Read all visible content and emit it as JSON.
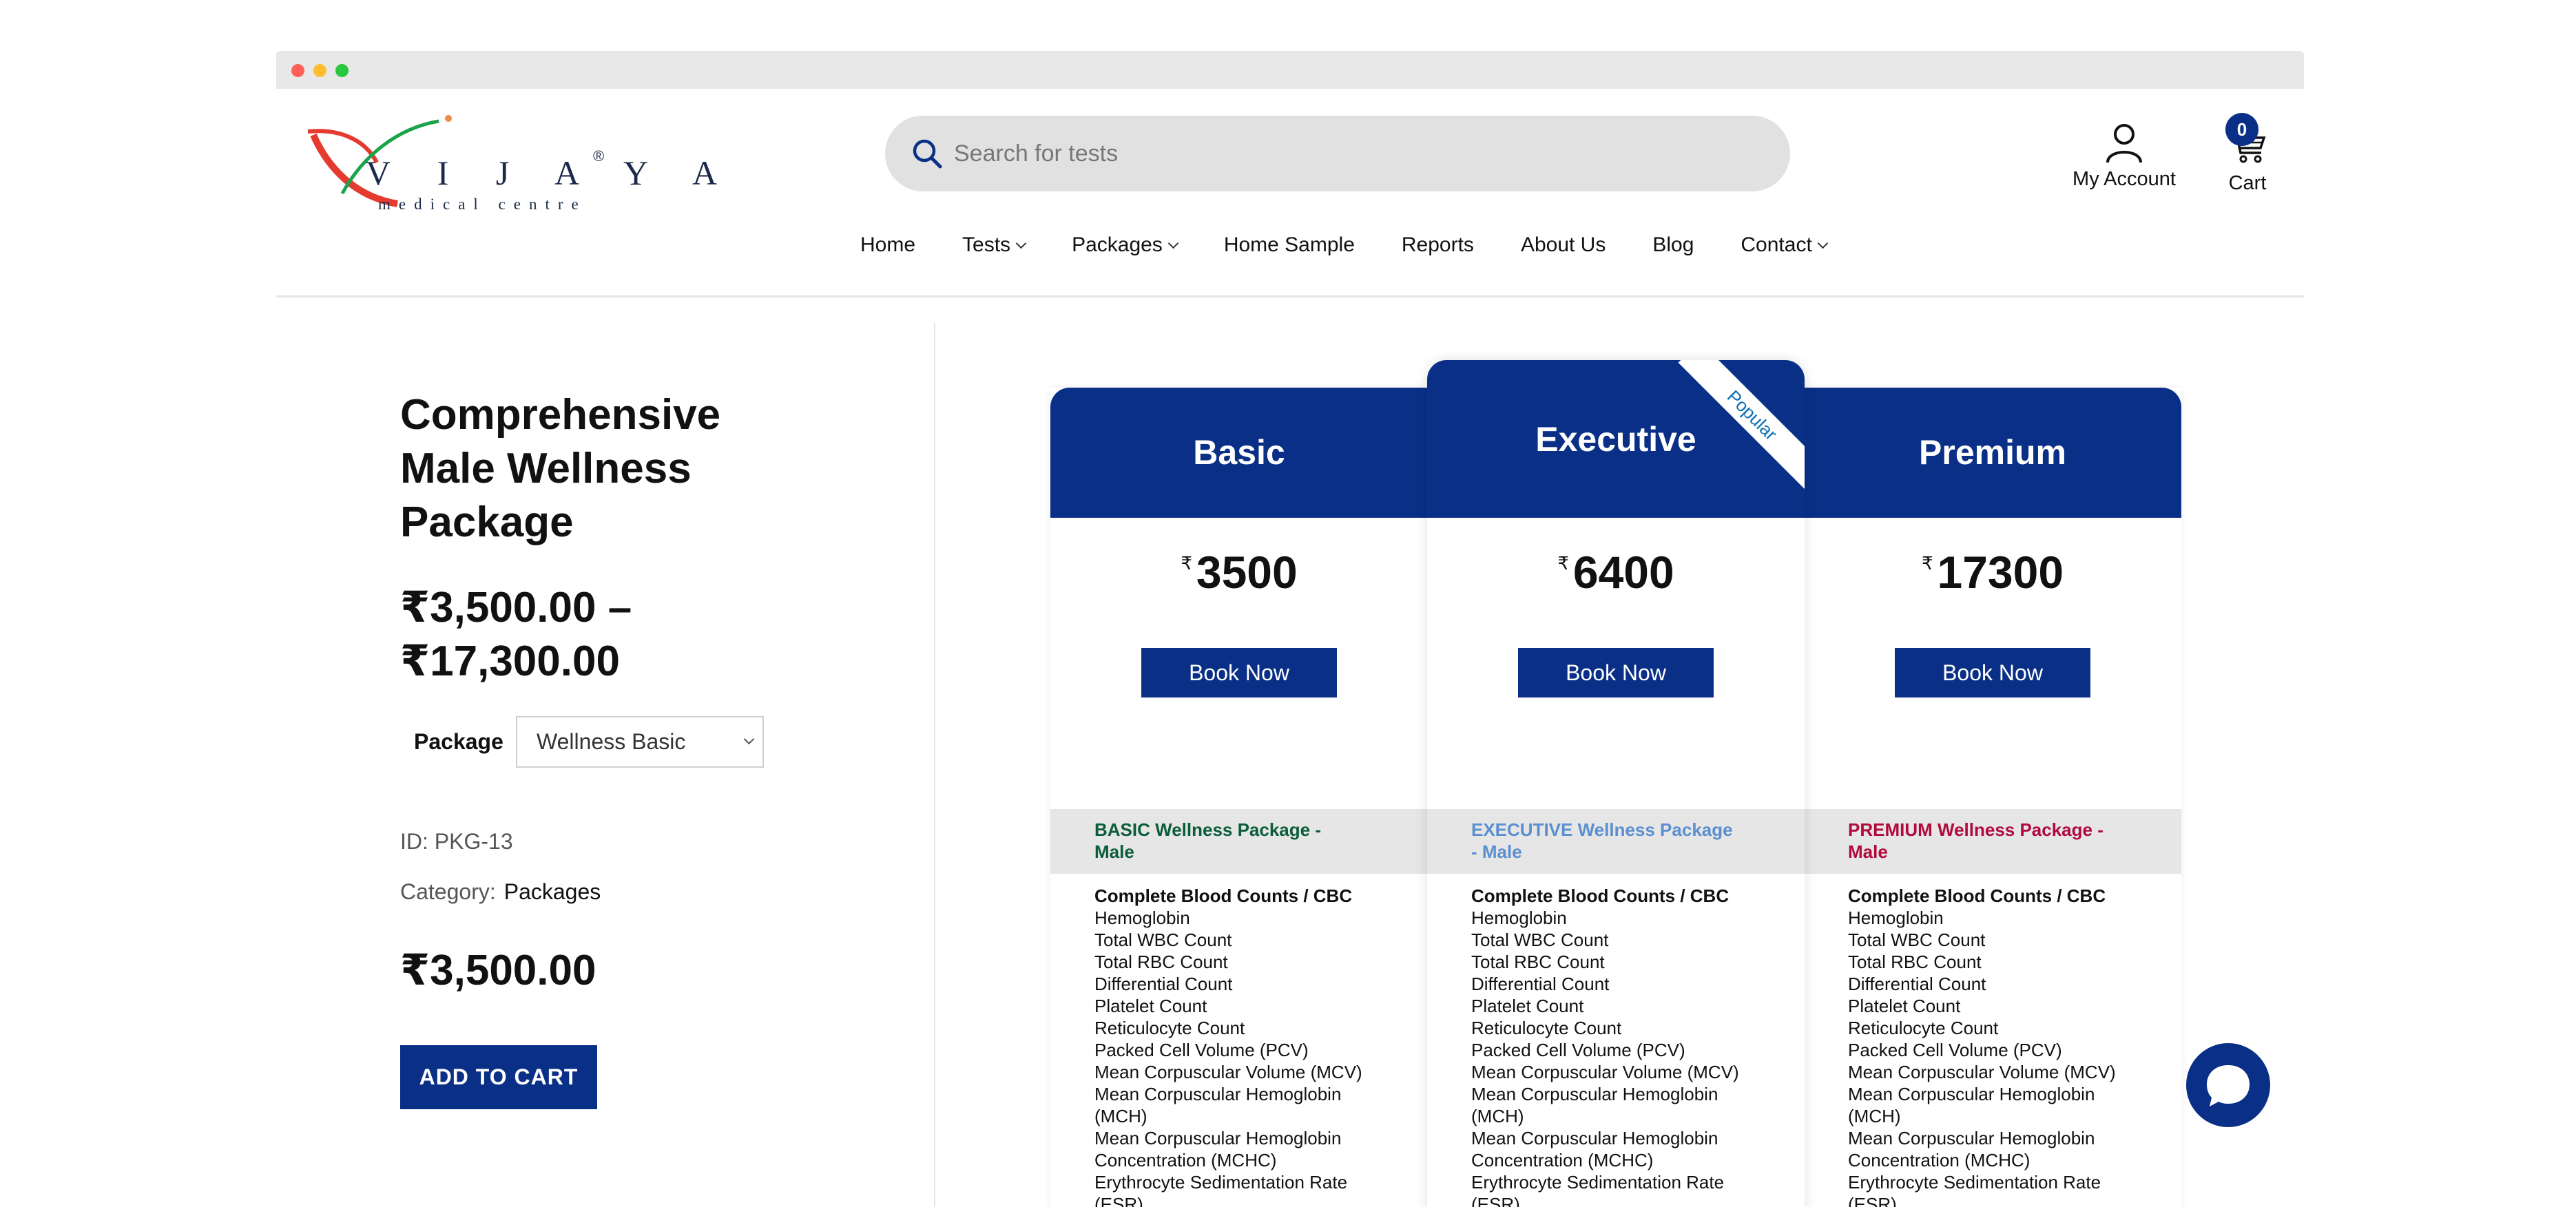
{
  "header": {
    "logo_text": "V I J A Y A",
    "logo_sub": "medical centre",
    "logo_reg": "®",
    "search_placeholder": "Search for tests",
    "account_label": "My Account",
    "cart_label": "Cart",
    "cart_count": "0"
  },
  "nav": {
    "items": [
      {
        "label": "Home"
      },
      {
        "label": "Tests"
      },
      {
        "label": "Packages"
      },
      {
        "label": "Home Sample"
      },
      {
        "label": "Reports"
      },
      {
        "label": "About Us"
      },
      {
        "label": "Blog"
      },
      {
        "label": "Contact"
      }
    ]
  },
  "product": {
    "title": "Comprehensive Male Wellness Package",
    "price_range": "₹3,500.00 – ₹17,300.00",
    "package_label": "Package",
    "package_selected": "Wellness Basic",
    "id_text": "ID: PKG-13",
    "category_label": "Category:",
    "category_value": "Packages",
    "price": "₹3,500.00",
    "add_to_cart": "ADD TO CART"
  },
  "plans": [
    {
      "name": "Basic",
      "currency": "₹",
      "price": "3500",
      "book_label": "Book Now",
      "band": "BASIC Wellness Package - Male",
      "band_color": "#0b5d3b"
    },
    {
      "name": "Executive",
      "currency": "₹",
      "price": "6400",
      "book_label": "Book Now",
      "band": "EXECUTIVE Wellness Package - Male",
      "band_color": "#5b8fd0",
      "ribbon": "Popular"
    },
    {
      "name": "Premium",
      "currency": "₹",
      "price": "17300",
      "book_label": "Book Now",
      "band": "PREMIUM Wellness Package - Male",
      "band_color": "#b00a3e"
    }
  ],
  "features": {
    "heading": "Complete Blood Counts / CBC",
    "items": [
      "Hemoglobin",
      "Total WBC Count",
      "Total RBC Count",
      "Differential Count",
      "Platelet Count",
      "Reticulocyte Count",
      "Packed Cell Volume (PCV)",
      "Mean Corpuscular Volume (MCV)",
      "Mean Corpuscular Hemoglobin (MCH)",
      "Mean Corpuscular Hemoglobin Concentration (MCHC)",
      "Erythrocyte Sedimentation Rate (ESR)"
    ]
  },
  "colors": {
    "brand_blue": "#0a2f87"
  }
}
